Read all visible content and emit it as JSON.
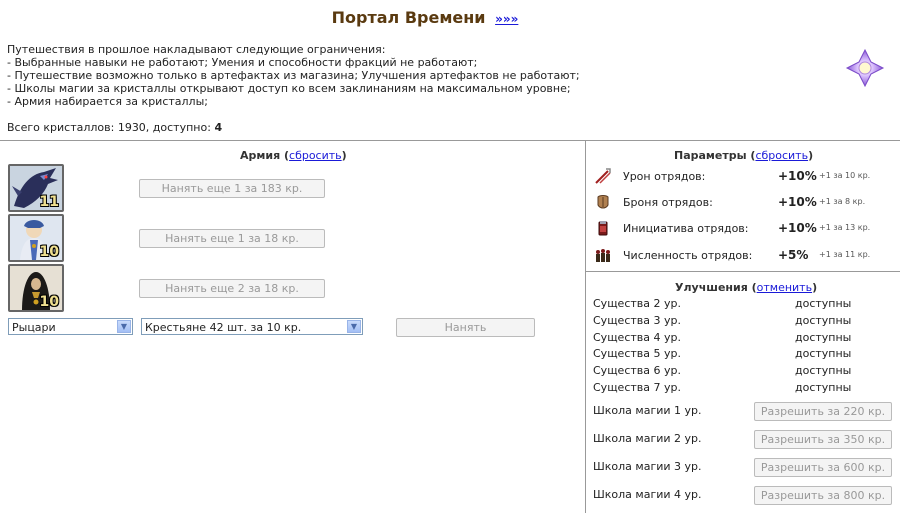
{
  "header": {
    "title": "Портал Времени",
    "title_link": "»»»"
  },
  "intro": {
    "heading": "Путешествия в прошлое накладывают следующие ограничения:",
    "lines": [
      "- Выбранные навыки не работают; Умения и способности фракций не работают;",
      "- Путешествие возможно только в артефактах из магазина; Улучшения артефактов не работают;",
      "- Школы магии за кристаллы открывают доступ ко всем заклинаниям на максимальном уровне;",
      "- Армия набирается за кристаллы;"
    ]
  },
  "crystals": {
    "label": "Всего кристаллов: 1930, доступно:",
    "available": "4"
  },
  "army": {
    "title": "Армия",
    "reset_link": "сбросить",
    "units": [
      {
        "count": "11",
        "icon": "dragon-unit-icon",
        "hire_label": "Нанять еще 1 за 183 кр."
      },
      {
        "count": "10",
        "icon": "priest-unit-icon",
        "hire_label": "Нанять еще 1 за 18 кр."
      },
      {
        "count": "10",
        "icon": "monk-unit-icon",
        "hire_label": "Нанять еще 2 за 18 кр."
      }
    ],
    "faction_select": "Рыцари",
    "unit_select": "Крестьяне 42 шт. за 10 кр.",
    "hire_button": "Нанять"
  },
  "params": {
    "title": "Параметры",
    "reset_link": "сбросить",
    "items": [
      {
        "icon": "damage-icon",
        "label": "Урон отрядов:",
        "value": "+10%",
        "cost": "+1 за 10 кр."
      },
      {
        "icon": "armor-icon",
        "label": "Броня отрядов:",
        "value": "+10%",
        "cost": "+1 за 8 кр."
      },
      {
        "icon": "initiative-icon",
        "label": "Инициатива отрядов:",
        "value": "+10%",
        "cost": "+1 за 13 кр."
      },
      {
        "icon": "troop-size-icon",
        "label": "Численность отрядов:",
        "value": "+5%",
        "cost": "+1 за 11 кр."
      }
    ]
  },
  "upgrades": {
    "title": "Улучшения",
    "cancel_link": "отменить",
    "creatures": [
      {
        "label": "Существа 2 ур.",
        "status": "доступны"
      },
      {
        "label": "Существа 3 ур.",
        "status": "доступны"
      },
      {
        "label": "Существа 4 ур.",
        "status": "доступны"
      },
      {
        "label": "Существа 5 ур.",
        "status": "доступны"
      },
      {
        "label": "Существа 6 ур.",
        "status": "доступны"
      },
      {
        "label": "Существа 7 ур.",
        "status": "доступны"
      }
    ],
    "magic": [
      {
        "label": "Школа магии 1 ур.",
        "button": "Разрешить за 220 кр."
      },
      {
        "label": "Школа магии 2 ур.",
        "button": "Разрешить за 350 кр."
      },
      {
        "label": "Школа магии 3 ур.",
        "button": "Разрешить за 600 кр."
      },
      {
        "label": "Школа магии 4 ур.",
        "button": "Разрешить за 800 кр."
      }
    ]
  },
  "colors": {
    "title": "#5a3a10",
    "link": "#1a1ad8",
    "divider": "#999999",
    "disabled_text": "#999999"
  }
}
